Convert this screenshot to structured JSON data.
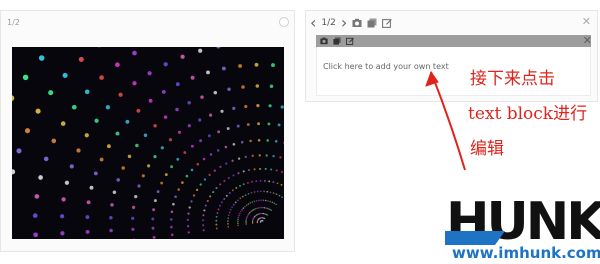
{
  "slider": {
    "counter": "1/2"
  },
  "editor": {
    "counter": "1/2",
    "prev_icon": "chevron-left-icon",
    "next_icon": "chevron-right-icon",
    "close_icon": "close-icon",
    "block_placeholder": "Click here to add your own text"
  },
  "annotation": {
    "line1": "接下来点击",
    "line2": "text block进行",
    "line3": "编辑",
    "color": "#e0231b"
  },
  "logo": {
    "word": "HUNK",
    "url": "www.imhunk.com",
    "url_color": "#1e73c4"
  }
}
